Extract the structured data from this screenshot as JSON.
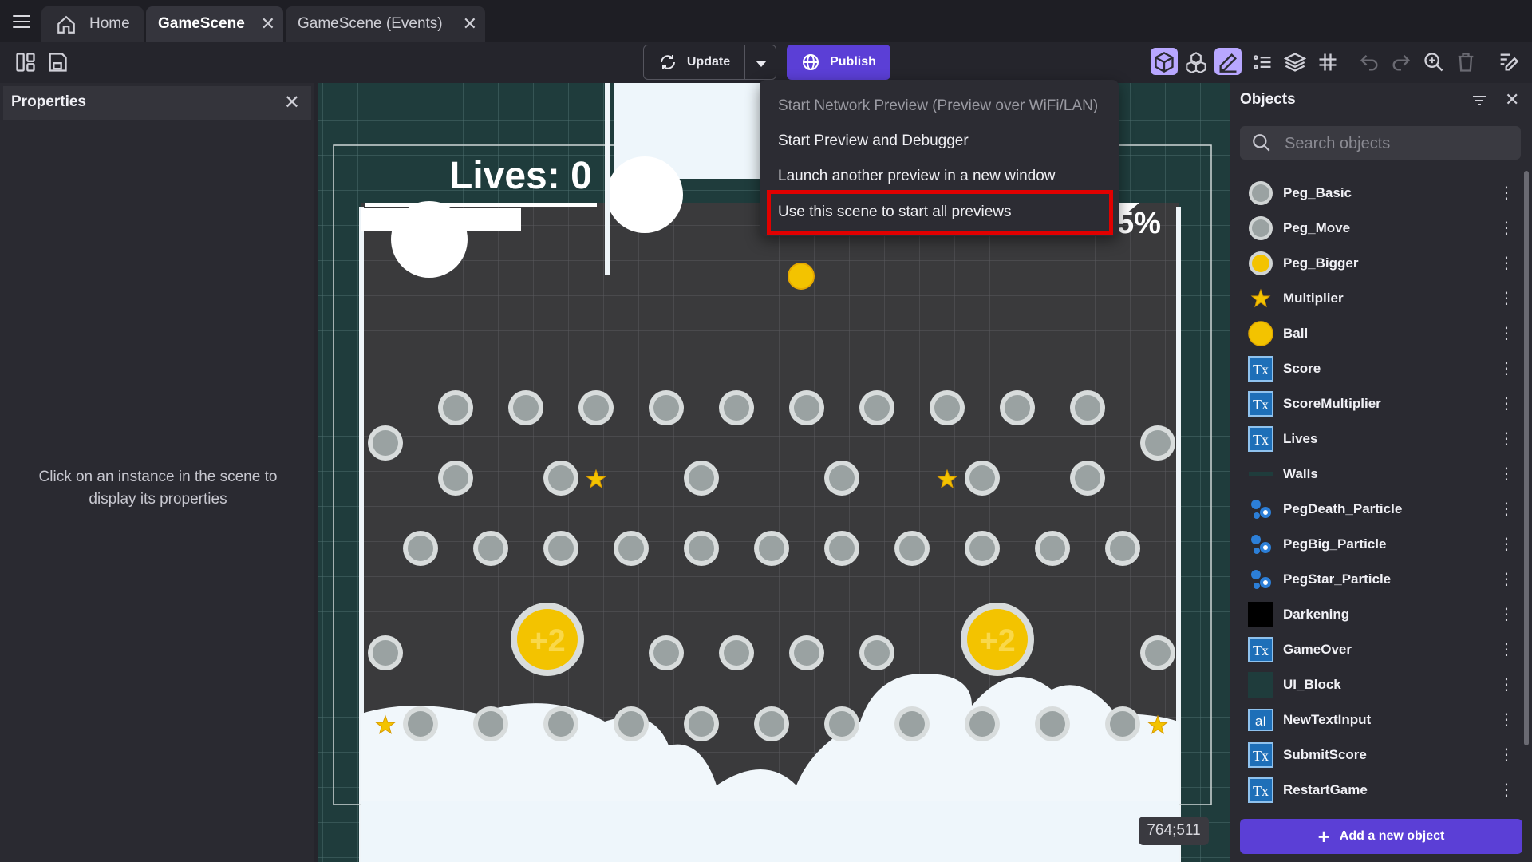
{
  "tabs": [
    {
      "label": "Home"
    },
    {
      "label": "GameScene"
    },
    {
      "label": "GameScene (Events)"
    }
  ],
  "toolbar": {
    "update_label": "Update",
    "publish_label": "Publish"
  },
  "properties": {
    "title": "Properties",
    "hint": "Click on an instance in the scene to display its properties"
  },
  "scene": {
    "lives_text": "Lives: 0",
    "percent_text": "5%",
    "bonus_text": "+2",
    "coords": "764;511"
  },
  "preview_menu": {
    "items": [
      {
        "label": "Start Network Preview (Preview over WiFi/LAN)",
        "disabled": true
      },
      {
        "label": "Start Preview and Debugger"
      },
      {
        "label": "Launch another preview in a new window"
      },
      {
        "label": "Use this scene to start all previews",
        "highlighted": true
      }
    ]
  },
  "objects": {
    "title": "Objects",
    "search_placeholder": "Search objects",
    "items": [
      {
        "name": "Peg_Basic",
        "icon": "peg-gray"
      },
      {
        "name": "Peg_Move",
        "icon": "peg-gray"
      },
      {
        "name": "Peg_Bigger",
        "icon": "peg-yellow"
      },
      {
        "name": "Multiplier",
        "icon": "star"
      },
      {
        "name": "Ball",
        "icon": "ball"
      },
      {
        "name": "Score",
        "icon": "text"
      },
      {
        "name": "ScoreMultiplier",
        "icon": "text"
      },
      {
        "name": "Lives",
        "icon": "text"
      },
      {
        "name": "Walls",
        "icon": "wall"
      },
      {
        "name": "PegDeath_Particle",
        "icon": "particle"
      },
      {
        "name": "PegBig_Particle",
        "icon": "particle"
      },
      {
        "name": "PegStar_Particle",
        "icon": "particle"
      },
      {
        "name": "Darkening",
        "icon": "black-square"
      },
      {
        "name": "GameOver",
        "icon": "text"
      },
      {
        "name": "UI_Block",
        "icon": "dark-square"
      },
      {
        "name": "NewTextInput",
        "icon": "text-input"
      },
      {
        "name": "SubmitScore",
        "icon": "text"
      },
      {
        "name": "RestartGame",
        "icon": "text"
      }
    ],
    "add_label": "Add a new object"
  },
  "colors": {
    "accent": "#5b3fd6",
    "highlight_border": "#e10000",
    "scene_bg": "#1f3c3c",
    "playfield": "#3a3a3c"
  }
}
